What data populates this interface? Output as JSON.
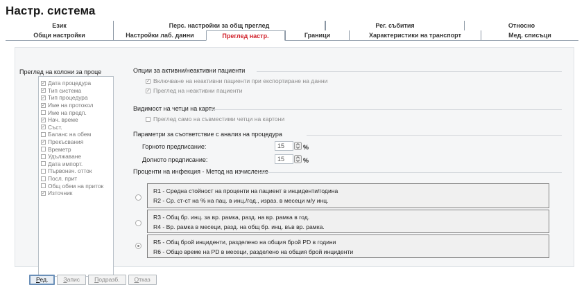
{
  "window": {
    "title": "Настр. система"
  },
  "tabs_back": [
    {
      "label": "Език"
    },
    {
      "label": "Перс. настройки за общ преглед"
    },
    {
      "label": ""
    },
    {
      "label": "Рег. събития"
    },
    {
      "label": "Относно"
    }
  ],
  "tabs_front": [
    {
      "label": "Общи настройки"
    },
    {
      "label": "Настройки лаб. данни"
    },
    {
      "label": "Преглед настр.",
      "active": true
    },
    {
      "label": "Граници"
    },
    {
      "label": "Характеристики на транспорт"
    },
    {
      "label": "Мед. списъци"
    }
  ],
  "columns": {
    "title": "Преглед на колони за проце",
    "items": [
      {
        "label": "Дата процедура",
        "checked": true
      },
      {
        "label": "Тип система",
        "checked": true
      },
      {
        "label": "Тип процедура",
        "checked": true
      },
      {
        "label": "Име на протокол",
        "checked": true
      },
      {
        "label": "Име на предп.",
        "checked": false
      },
      {
        "label": "Нач. време",
        "checked": true
      },
      {
        "label": "Съст.",
        "checked": true
      },
      {
        "label": "Баланс на обем",
        "checked": false
      },
      {
        "label": "Прекъсвания",
        "checked": true
      },
      {
        "label": "Времетр",
        "checked": false
      },
      {
        "label": "Удължаване",
        "checked": false
      },
      {
        "label": "Дата импорт.",
        "checked": false
      },
      {
        "label": "Първонач. отток",
        "checked": false
      },
      {
        "label": "Посл. прит",
        "checked": false
      },
      {
        "label": "Общ обем на приток",
        "checked": false
      },
      {
        "label": "Източник",
        "checked": true
      }
    ]
  },
  "active_patients": {
    "title": "Опции за активни/неактивни пациенти",
    "opt1": "Включване на неактивни пациенти при експортиране на данни",
    "opt1_checked": true,
    "opt2": "Преглед на неактивни пациенти",
    "opt2_checked": true
  },
  "card_readers": {
    "title": "Видимост на четци на карти",
    "opt1": "Преглед само на съвместими четци на картони",
    "opt1_checked": false
  },
  "matching": {
    "title": "Параметри за съответствие с анализ на процедура",
    "upper_label": "Горното предписание:",
    "upper_value": "15",
    "lower_label": "Долното предписание:",
    "lower_value": "15",
    "unit": "%"
  },
  "infection": {
    "title": "Проценти на инфекция - Метод на изчисление",
    "methods": [
      {
        "line1": "R1 - Средна стойност на проценти на пациент в инциденти/година",
        "line2": "R2 - Ср. ст-ст на % на пац. в инц./год., израз. в месеци м/у инц.",
        "selected": false
      },
      {
        "line1": "R3 - Общ бр. инц. за вр. рамка, разд. на вр. рамка в год.",
        "line2": "R4 - Вр. рамка в месеци, разд. на общ бр. инц. във вр. рамка.",
        "selected": false
      },
      {
        "line1": "R5 - Общ брой инциденти, разделено на общия брой PD в години",
        "line2": "R6 - Общо време на PD в месеци, разделено на общия брой инциденти",
        "selected": true
      }
    ]
  },
  "buttons": {
    "edit": "Ред.",
    "save": "Запис",
    "default": "Подразб.",
    "cancel": "Отказ"
  },
  "colors": {
    "active_tab": "#d0202a",
    "accent_border": "#6a8fb8"
  }
}
